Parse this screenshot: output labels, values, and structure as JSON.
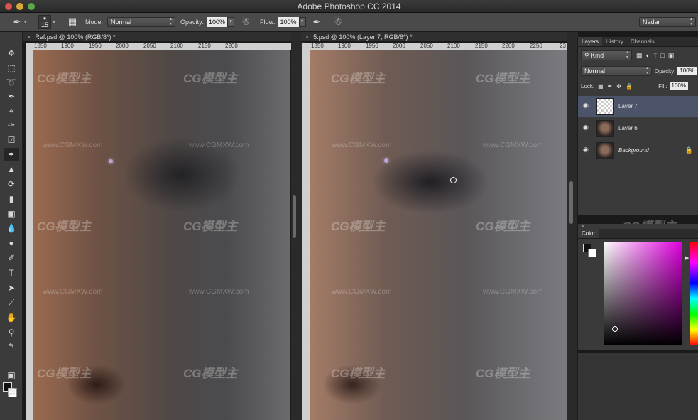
{
  "window": {
    "title": "Adobe Photoshop CC 2014"
  },
  "options_bar": {
    "brush_size": "15",
    "mode_label": "Mode:",
    "mode_value": "Normal",
    "opacity_label": "Opacity:",
    "opacity_value": "100%",
    "flow_label": "Flow:",
    "flow_value": "100%",
    "workspace": "Nadar"
  },
  "documents": [
    {
      "tab": "Ref.psd @ 100% (RGB/8*) *",
      "ruler_ticks": [
        "1850",
        "1900",
        "1950",
        "2000",
        "2050",
        "2100",
        "2150",
        "2200"
      ]
    },
    {
      "tab": "5.psd @ 100% (Layer 7, RGB/8*) *",
      "ruler_ticks": [
        "1850",
        "1900",
        "1950",
        "2000",
        "2050",
        "2100",
        "2150",
        "2200",
        "2250",
        "23"
      ]
    }
  ],
  "layers_panel": {
    "tabs": [
      "Layers",
      "History",
      "Channels"
    ],
    "kind_label": "Kind",
    "blend_mode": "Normal",
    "opacity_label": "Opacity:",
    "opacity_value": "100%",
    "lock_label": "Lock:",
    "fill_label": "Fill:",
    "fill_value": "100%",
    "layers": [
      {
        "name": "Layer 7",
        "selected": true,
        "thumb": "transparent"
      },
      {
        "name": "Layer 6",
        "selected": false,
        "thumb": "face"
      },
      {
        "name": "Background",
        "selected": false,
        "thumb": "face",
        "locked": true
      }
    ]
  },
  "color_panel": {
    "title": "Color"
  },
  "watermark": {
    "logo_text": "CG模型主",
    "url_text": "www.CGMXW.com"
  },
  "colors": {
    "selected_layer": "#4b5468",
    "accent_magenta": "#e000e0"
  }
}
